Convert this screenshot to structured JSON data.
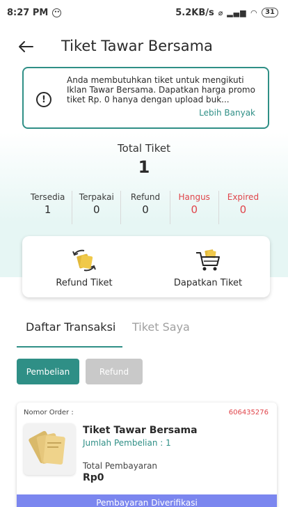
{
  "status_bar": {
    "time": "8:27 PM",
    "speed": "5.2KB/s",
    "battery": "31"
  },
  "header": {
    "title": "Tiket Tawar Bersama"
  },
  "info_banner": {
    "message": "Anda membutuhkan tiket untuk mengikuti Iklan Tawar Bersama. Dapatkan harga promo tiket Rp. 0 hanya dengan upload buk...",
    "more_link": "Lebih Banyak"
  },
  "summary": {
    "total_label": "Total Tiket",
    "total_value": "1",
    "stats": [
      {
        "label": "Tersedia",
        "value": "1"
      },
      {
        "label": "Terpakai",
        "value": "0"
      },
      {
        "label": "Refund",
        "value": "0"
      },
      {
        "label": "Hangus",
        "value": "0"
      },
      {
        "label": "Expired",
        "value": "0"
      }
    ]
  },
  "actions": {
    "refund_label": "Refund Tiket",
    "get_label": "Dapatkan Tiket"
  },
  "tabs": {
    "transactions": "Daftar Transaksi",
    "my_tickets": "Tiket Saya"
  },
  "filters": {
    "purchase": "Pembelian",
    "refund": "Refund"
  },
  "order": {
    "label": "Nomor Order :",
    "number": "606435276",
    "name": "Tiket Tawar Bersama",
    "quantity": "Jumlah Pembelian : 1",
    "total_label": "Total Pembayaran",
    "total": "Rp0",
    "status": "Pembayaran Diverifikasi"
  },
  "colors": {
    "accent": "#2f8f86",
    "alert": "#e0444a",
    "verified": "#7b86ef"
  }
}
